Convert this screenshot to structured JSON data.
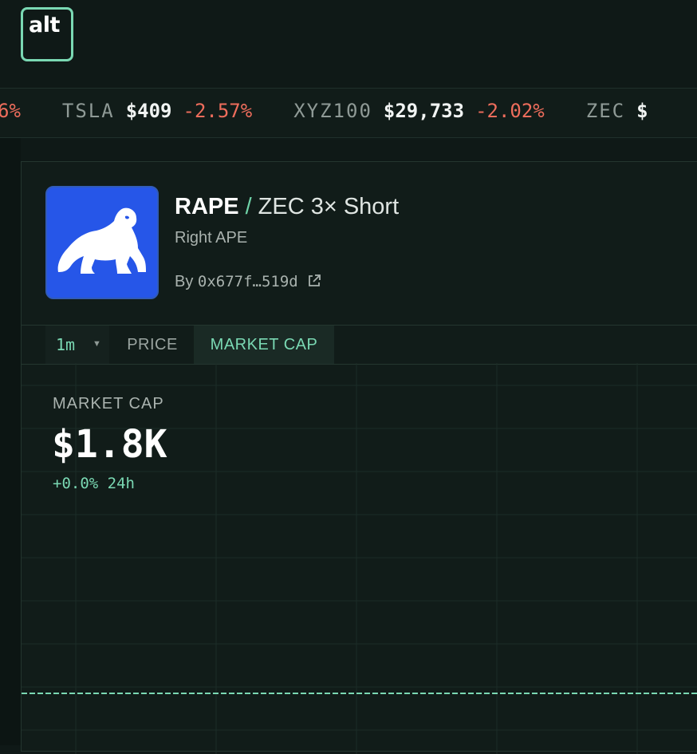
{
  "app": {
    "logo_text": "alt"
  },
  "ticker": {
    "items": [
      {
        "symbol": "",
        "price": "",
        "change": "6%"
      },
      {
        "symbol": "TSLA",
        "price": "$409",
        "change": "-2.57%"
      },
      {
        "symbol": "XYZ100",
        "price": "$29,733",
        "change": "-2.02%"
      },
      {
        "symbol": "ZEC",
        "price": "$",
        "change": ""
      }
    ]
  },
  "token": {
    "symbol": "RAPE",
    "separator": "/",
    "name": "ZEC 3× Short",
    "subtitle": "Right APE",
    "by_label": "By",
    "creator_address": "0x677f…519d",
    "icon": "gorilla-logo",
    "icon_bg": "#2656e8"
  },
  "controls": {
    "interval": "1m",
    "tabs": [
      {
        "label": "PRICE",
        "active": false
      },
      {
        "label": "MARKET CAP",
        "active": true
      }
    ]
  },
  "chart": {
    "metric_label": "MARKET CAP",
    "metric_value": "$1.8K",
    "change_text": "+0.0% 24h",
    "accent": "#7ad8b3",
    "negative": "#ee6d5c"
  },
  "chart_data": {
    "type": "line",
    "title": "",
    "xlabel": "",
    "ylabel": "",
    "series": [
      {
        "values": [
          1.8,
          1.8,
          1.8,
          1.8,
          1.8,
          1.8,
          1.8,
          1.8,
          1.8,
          1.8,
          1.8,
          1.8,
          1.8,
          1.8,
          1.8
        ]
      }
    ],
    "line_style": "dashed",
    "grid": true
  }
}
